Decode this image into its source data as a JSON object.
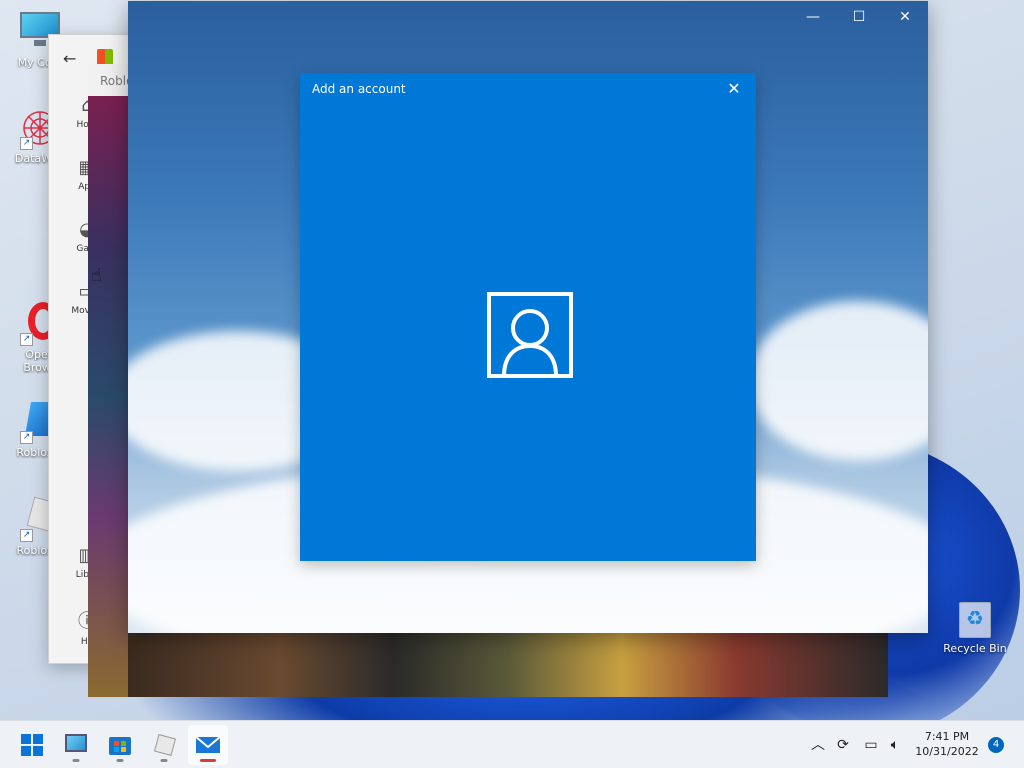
{
  "desktop": {
    "icons": [
      {
        "label": "My Com"
      },
      {
        "label": "DataWag"
      },
      {
        "label": "Open",
        "label2": "Brows"
      },
      {
        "label": "Roblox S"
      },
      {
        "label": "Roblox P"
      }
    ],
    "recycle_bin": "Recycle Bin"
  },
  "store": {
    "nav": [
      "Hom",
      "App",
      "Gam",
      "Movies",
      "Libra",
      "He"
    ],
    "roblox_title": "Roblo"
  },
  "dialog": {
    "title": "Add an account"
  },
  "taskbar": {
    "time": "7:41 PM",
    "date": "10/31/2022",
    "notification_count": "4"
  },
  "colors": {
    "accent": "#0078d7",
    "taskbar": "#eef1f5"
  }
}
